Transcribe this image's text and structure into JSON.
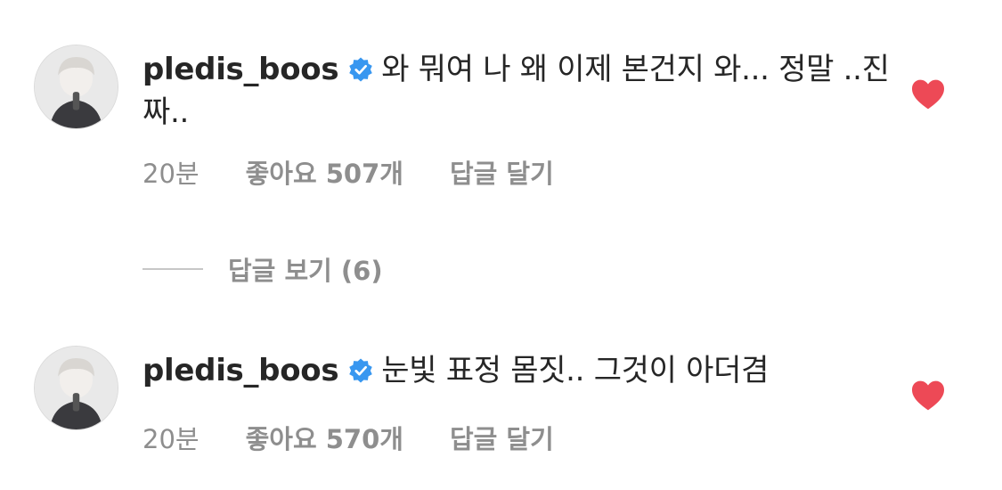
{
  "comments": [
    {
      "username": "pledis_boos",
      "text": "와 뭐여 나 왜 이제 본건지 와... 정말 ..진짜..",
      "time": "20분",
      "likes": "좋아요 507개",
      "reply": "답글 달기"
    },
    {
      "username": "pledis_boos",
      "text": "눈빛 표정 몸짓.. 그것이 아더겸",
      "time": "20분",
      "likes": "좋아요 570개",
      "reply": "답글 달기"
    }
  ],
  "view_replies": {
    "label": "답글 보기 (6)"
  },
  "icons": {
    "verified": "verified-badge-icon",
    "like": "heart-icon"
  },
  "colors": {
    "heart": "#ed4956",
    "verified": "#3897f0",
    "meta": "#8e8e8e",
    "text": "#262626"
  }
}
